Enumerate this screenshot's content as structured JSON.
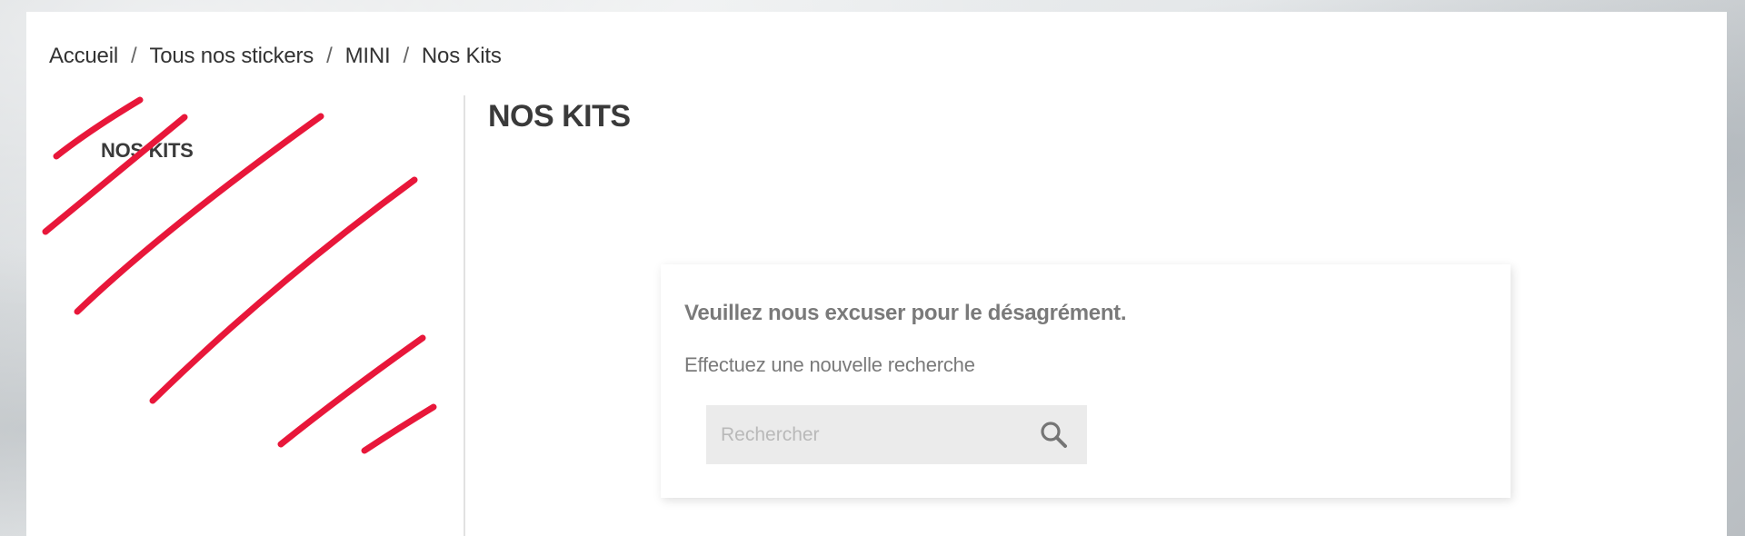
{
  "breadcrumb": {
    "items": [
      "Accueil",
      "Tous nos stickers",
      "MINI",
      "Nos Kits"
    ],
    "separator": "/"
  },
  "sidebar": {
    "title": "NOS KITS"
  },
  "page": {
    "title": "NOS KITS"
  },
  "notice": {
    "title": "Veuillez nous excuser pour le désagrément.",
    "text": "Effectuez une nouvelle recherche"
  },
  "search": {
    "placeholder": "Rechercher",
    "value": "",
    "icon": "search-icon"
  },
  "colors": {
    "scribble": "#e8173a",
    "page_background": "#ffffff",
    "search_background": "#ebebeb"
  }
}
